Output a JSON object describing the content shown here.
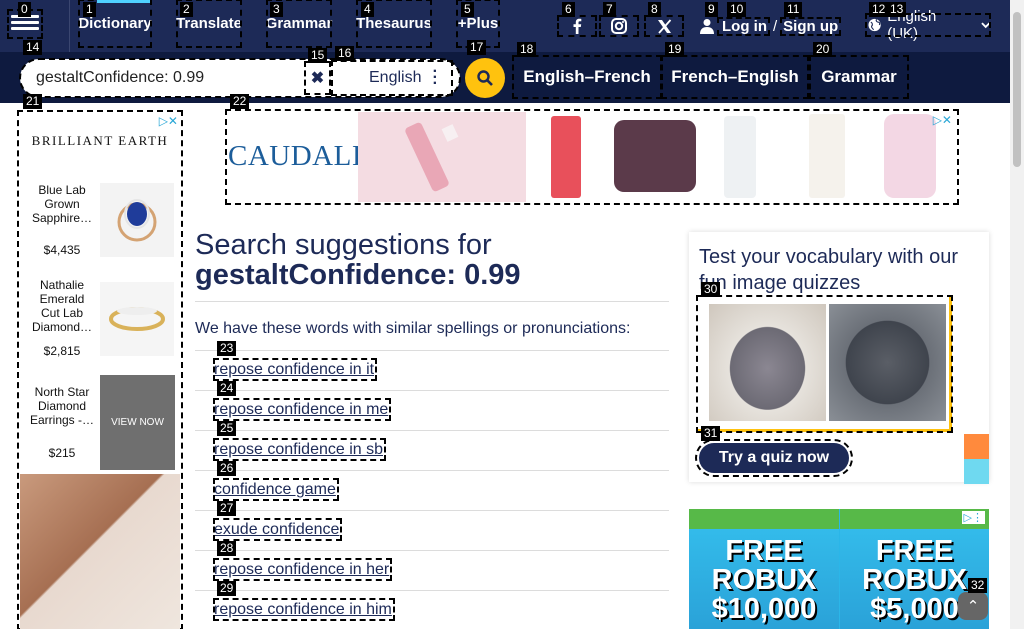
{
  "nav": {
    "menu_label": "Menu",
    "links": [
      "Dictionary",
      "Translate",
      "Grammar",
      "Thesaurus",
      "+Plus"
    ],
    "login": "Log in",
    "sep": "/",
    "signup": "Sign up",
    "language": "English (UK)",
    "icons": [
      "facebook-icon",
      "instagram-icon",
      "x-icon",
      "user-icon",
      "globe-icon",
      "chevron-down-icon"
    ]
  },
  "search": {
    "value": "gestaltConfidence: 0.99",
    "clear": "✖",
    "dictionary": "English",
    "dict_links": [
      "English–French",
      "French–English",
      "Grammar"
    ]
  },
  "left_ad": {
    "brand": "BRILLIANT EARTH",
    "products": [
      {
        "name": "Blue Lab Grown Sapphire…",
        "price": "$4,435"
      },
      {
        "name": "Nathalie Emerald Cut Lab Diamond…",
        "price": "$2,815"
      },
      {
        "name": "North Star Diamond Earrings -…",
        "price": "$215"
      }
    ],
    "view_now": "VIEW NOW"
  },
  "banner_ad": {
    "brand": "CAUDALIE"
  },
  "main": {
    "title_pre": "Search suggestions for",
    "title_term": "gestaltConfidence: 0.99",
    "intro": "We have these words with similar spellings or pronunciations:",
    "suggestions": [
      "repose confidence in it",
      "repose confidence in me",
      "repose confidence in sb",
      "confidence game",
      "exude confidence",
      "repose confidence in her",
      "repose confidence in him"
    ]
  },
  "quiz": {
    "title": "Test your vocabulary with our fun image quizzes",
    "button": "Try a quiz now"
  },
  "roblox_ad": {
    "left": "FREE ROBUX $10,000",
    "right": "FREE ROBUX $5,000",
    "free": "FREE",
    "robux": "ROBUX",
    "amount1": "$10,000",
    "amount2": "$5,000"
  },
  "markers": [
    "0",
    "1",
    "2",
    "3",
    "4",
    "5",
    "6",
    "7",
    "8",
    "9",
    "10",
    "11",
    "12",
    "13",
    "14",
    "15",
    "16",
    "17",
    "18",
    "19",
    "20",
    "21",
    "22",
    "23",
    "24",
    "25",
    "26",
    "27",
    "28",
    "29",
    "30",
    "31",
    "32"
  ],
  "colors": {
    "navy": "#1d2a57",
    "dark_navy": "#0e1a3f",
    "yellow": "#ffc20e"
  }
}
